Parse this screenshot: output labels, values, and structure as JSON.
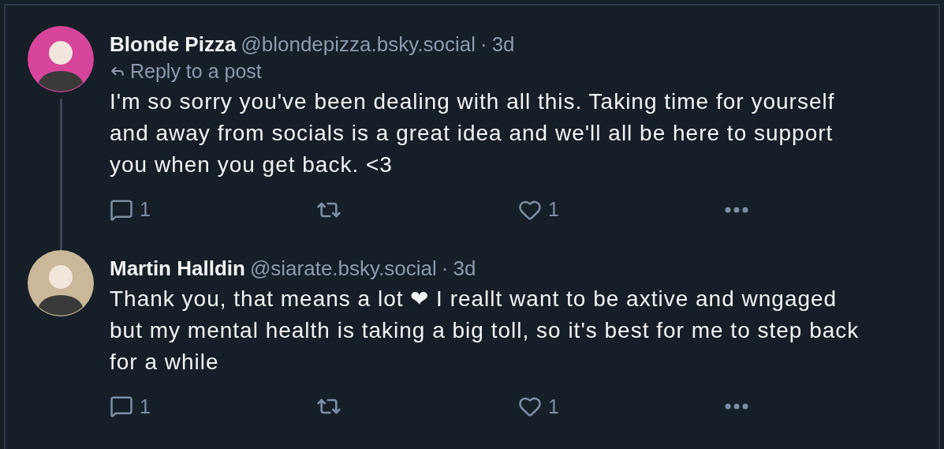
{
  "posts": [
    {
      "author": "Blonde Pizza",
      "handle": "@blondepizza.bsky.social",
      "separator": "·",
      "time": "3d",
      "reply_context": "Reply to a post",
      "text": "I'm so sorry you've been dealing with all this. Taking time for yourself and away from socials is a great idea and we'll all be here to support you when you get back. <3",
      "reply_count": "1",
      "like_count": "1",
      "thread_line": true
    },
    {
      "author": "Martin Halldin",
      "handle": "@siarate.bsky.social",
      "separator": "·",
      "time": "3d",
      "text": "Thank you, that means a lot ❤ I reallt want to be axtive and wngaged but my mental health is taking a big toll, so it's best for me to step back for a while",
      "reply_count": "1",
      "like_count": "1",
      "thread_line": false
    }
  ]
}
